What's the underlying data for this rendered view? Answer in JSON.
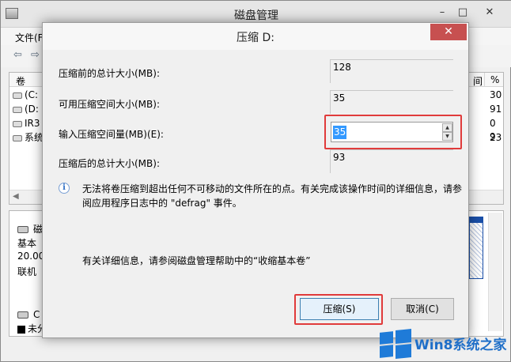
{
  "app": {
    "title": "磁盘管理",
    "controls": {
      "minimize": "–",
      "maximize": "□",
      "close": "✕"
    },
    "menu": {
      "file": "文件(F)"
    },
    "toolbar": {
      "back": "⇦",
      "forward": "⇨"
    },
    "volume_list": {
      "header_volume": "卷",
      "header_col_a": "间",
      "header_col_b": "%",
      "rows": [
        {
          "name": "(C:",
          "pct": "30"
        },
        {
          "name": "(D:",
          "pct": "91"
        },
        {
          "name": "IR3",
          "pct": "0 9"
        },
        {
          "name": "系统",
          "pct": "23"
        }
      ]
    },
    "disk_panel": {
      "disk_name": "磁",
      "type": "基本",
      "size": "20.00",
      "status": "联机",
      "cdrom_name": "C",
      "legend_unallocated": "未分"
    }
  },
  "dialog": {
    "title": "压缩 D:",
    "close_label": "✕",
    "fields": {
      "total_before_label": "压缩前的总计大小(MB):",
      "total_before_value": "128",
      "available_label": "可用压缩空间大小(MB):",
      "available_value": "35",
      "input_label": "输入压缩空间量(MB)(E):",
      "input_value": "35",
      "total_after_label": "压缩后的总计大小(MB):",
      "total_after_value": "93"
    },
    "spin": {
      "up": "▲",
      "down": "▼"
    },
    "info_icon": "i",
    "info_text": "无法将卷压缩到超出任何不可移动的文件所在的点。有关完成该操作时间的详细信息，请参阅应用程序日志中的 \"defrag\" 事件。",
    "help_text": "有关详细信息，请参阅磁盘管理帮助中的“收缩基本卷”",
    "ok_button": "压缩(S)",
    "cancel_button": "取消(C)"
  },
  "watermark": {
    "text": "Win8系统之家"
  },
  "colors": {
    "highlight": "#e03b3b",
    "selection": "#3399ff",
    "close": "#c75050",
    "brand": "#1f7bd8"
  }
}
